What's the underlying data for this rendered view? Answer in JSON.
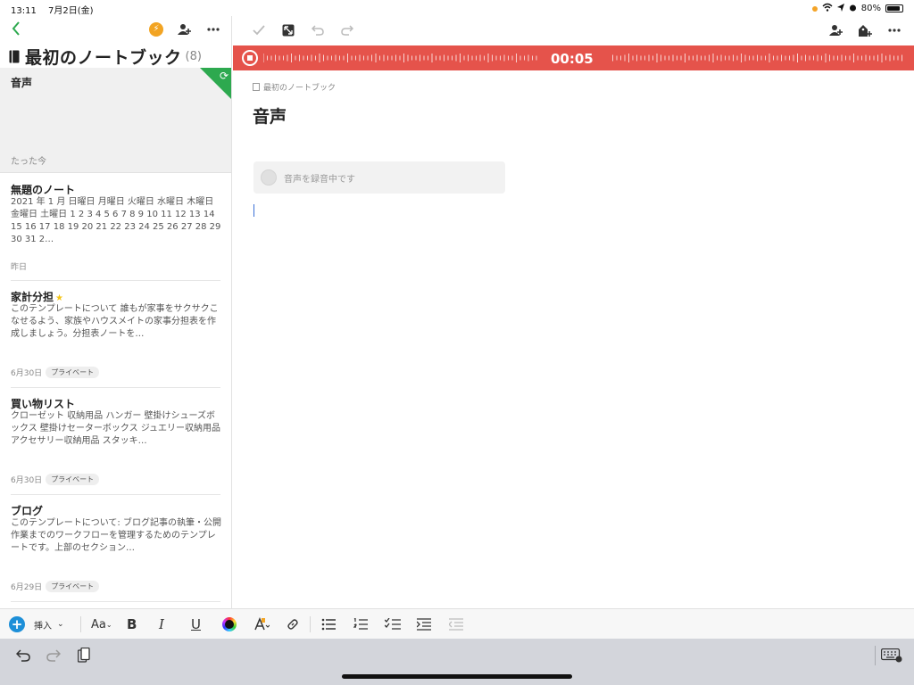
{
  "status_bar": {
    "time": "13:11",
    "date": "7月2日(金)",
    "battery": "80%"
  },
  "notebook": {
    "name": "最初のノートブック",
    "count": "(8)"
  },
  "notes": [
    {
      "title": "音声",
      "date": "たった今",
      "selected": true
    },
    {
      "title": "無題のノート",
      "body": "2021 年 1 月 日曜日 月曜日 火曜日 水曜日 木曜日 金曜日 土曜日 1 2 3 4 5 6 7 8 9 10 11 12 13 14 15 16 17 18 19 20 21 22 23 24 25 26 27 28 29 30 31 2…",
      "date": "昨日"
    },
    {
      "title": "家計分担",
      "body": "このテンプレートについて 誰もが家事をサクサクこなせるよう、家族やハウスメイトの家事分担表を作成しましょう。分担表ノートを…",
      "date": "6月30日",
      "tag": "プライベート",
      "starred": true
    },
    {
      "title": "買い物リスト",
      "body": "クローゼット 収納用品 ハンガー 壁掛けシューズボックス 壁掛けセーターボックス ジュエリー収納用品 アクセサリー収納用品 スタッキ…",
      "date": "6月30日",
      "tag": "プライベート"
    },
    {
      "title": "ブログ",
      "body": "このテンプレートについて: ブログ記事の執筆・公開作業までのワークフローを管理するためのテンプレートです。上部のセクション…",
      "date": "6月29日",
      "tag": "プライベート"
    }
  ],
  "editor": {
    "breadcrumb": "最初のノートブック",
    "title": "音声",
    "recording_label": "音声を録音中です",
    "timer": "00:05"
  },
  "format_toolbar": {
    "insert_label": "挿入",
    "font_label": "Aa",
    "bold": "B",
    "italic": "I",
    "underline": "U"
  },
  "colors": {
    "record_bar": "#e5534b",
    "sync_green": "#2da94f",
    "insert_blue": "#1d8fd8",
    "back_green": "#2da94f"
  }
}
